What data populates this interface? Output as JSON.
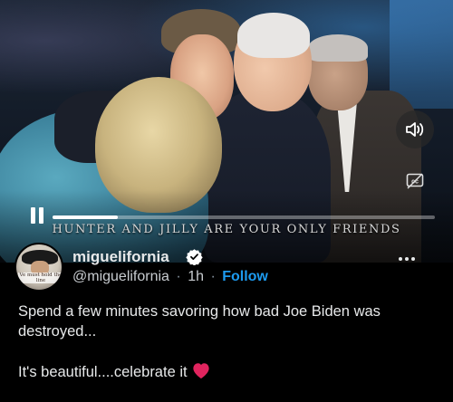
{
  "video": {
    "caption": "HUNTER AND JILLY ARE YOUR ONLY FRIENDS",
    "progress": 0.17,
    "controls": {
      "play_state_icon": "pause-icon",
      "volume_icon": "speaker-icon",
      "captions_icon": "cc-icon"
    }
  },
  "post": {
    "avatar_text": "Ve must hold the line",
    "display_name": "miguelifornia",
    "verified": true,
    "handle": "@miguelifornia",
    "time": "1h",
    "separator": "·",
    "follow_label": "Follow",
    "text_line_1": "Spend a few minutes savoring how bad Joe Biden was destroyed...",
    "text_line_2": "It's beautiful....celebrate it",
    "emoji": "heart-icon"
  },
  "colors": {
    "background": "#000000",
    "text": "#e7e9ea",
    "accent": "#1d9bf0",
    "heart": "#f91880",
    "verified_badge": "#ffffff"
  }
}
